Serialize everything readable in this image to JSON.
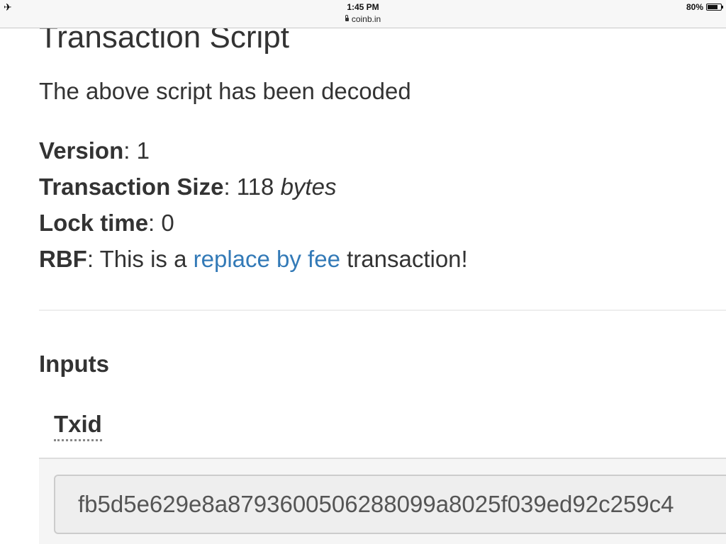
{
  "status_bar": {
    "airplane_icon": "airplane-icon",
    "time": "1:45 PM",
    "url": "coinb.in",
    "battery_text": "80%",
    "battery_level": 0.8
  },
  "page": {
    "title": "Transaction Script",
    "decoded_message": "The above script has been decoded",
    "details": {
      "version_label": "Version",
      "version_value": "1",
      "size_label": "Transaction Size",
      "size_value": "118",
      "size_unit": "bytes",
      "locktime_label": "Lock time",
      "locktime_value": "0",
      "rbf_label": "RBF",
      "rbf_prefix": "This is a",
      "rbf_link": "replace by fee",
      "rbf_suffix": "transaction!"
    },
    "inputs_heading": "Inputs",
    "table": {
      "column_header": "Txid",
      "txid_value": "fb5d5e629e8a8793600506288099a8025f039ed92c259c4"
    }
  },
  "colors": {
    "link": "#337ab7",
    "text": "#333333"
  }
}
